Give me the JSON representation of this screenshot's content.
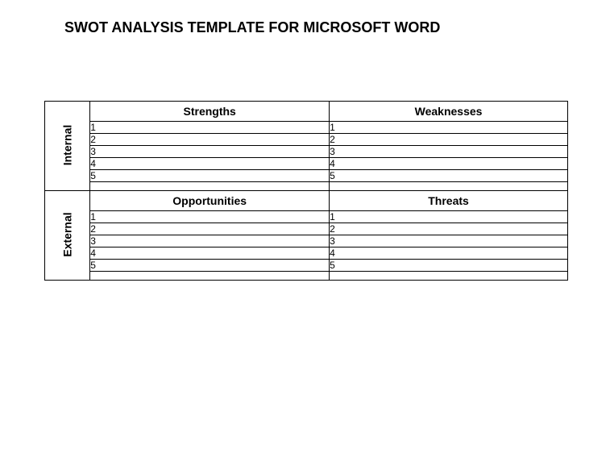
{
  "title": "SWOT ANALYSIS TEMPLATE FOR MICROSOFT WORD",
  "sections": {
    "internal": {
      "label": "Internal",
      "left": {
        "header": "Strengths",
        "items": [
          "1",
          "2",
          "3",
          "4",
          "5"
        ]
      },
      "right": {
        "header": "Weaknesses",
        "items": [
          "1",
          "2",
          "3",
          "4",
          "5"
        ]
      }
    },
    "external": {
      "label": "External",
      "left": {
        "header": "Opportunities",
        "items": [
          "1",
          "2",
          "3",
          "4",
          "5"
        ]
      },
      "right": {
        "header": "Threats",
        "items": [
          "1",
          "2",
          "3",
          "4",
          "5"
        ]
      }
    }
  }
}
